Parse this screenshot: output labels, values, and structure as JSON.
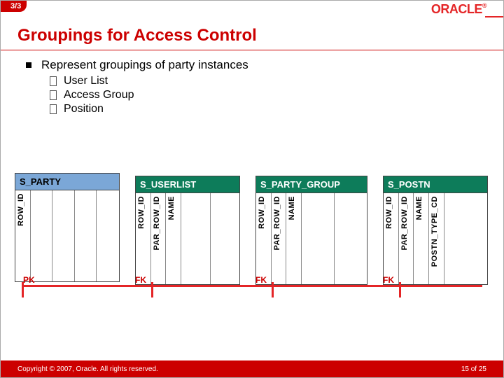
{
  "slide_counter": "3/3",
  "logo_text": "ORACLE",
  "logo_reg": "®",
  "title": "Groupings for Access Control",
  "bullet_main": "Represent groupings of party instances",
  "sub_bullets": [
    "User List",
    "Access Group",
    "Position"
  ],
  "tables": {
    "party": {
      "name": "S_PARTY",
      "cols": [
        "ROW_ID",
        "",
        "",
        "",
        ""
      ]
    },
    "userlist": {
      "name": "S_USERLIST",
      "cols": [
        "ROW_ID",
        "PAR_ROW_ID",
        "NAME",
        "",
        ""
      ]
    },
    "partygroup": {
      "name": "S_PARTY_GROUP",
      "cols": [
        "ROW_ID",
        "PAR_ROW_ID",
        "NAME",
        "",
        ""
      ]
    },
    "postn": {
      "name": "S_POSTN",
      "cols": [
        "ROW_ID",
        "PAR_ROW_ID",
        "NAME",
        "POSTN_TYPE_CD",
        ""
      ]
    }
  },
  "fk": {
    "pk": "PK",
    "fk": "FK"
  },
  "footer": {
    "copyright": "Copyright © 2007, Oracle. All rights reserved.",
    "page": "15 of 25"
  }
}
